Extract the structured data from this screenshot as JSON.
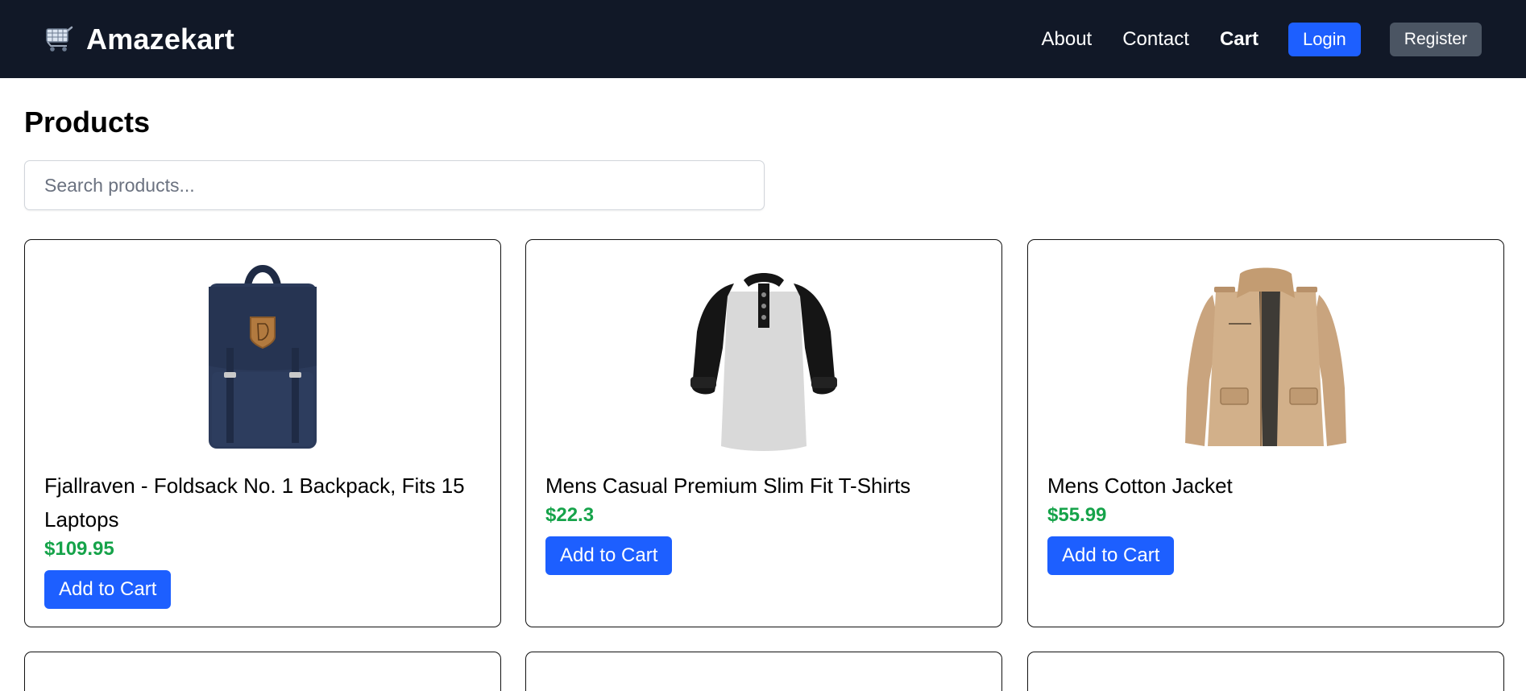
{
  "header": {
    "brand_name": "Amazekart",
    "brand_icon": "shopping-cart-icon",
    "links": {
      "about": "About",
      "contact": "Contact",
      "cart": "Cart"
    },
    "login_label": "Login",
    "register_label": "Register"
  },
  "main": {
    "title": "Products",
    "search": {
      "placeholder": "Search products...",
      "value": ""
    },
    "products": [
      {
        "name": "Fjallraven - Foldsack No. 1 Backpack, Fits 15 Laptops",
        "price": "$109.95",
        "button_label": "Add to Cart",
        "image": "backpack"
      },
      {
        "name": "Mens Casual Premium Slim Fit T-Shirts",
        "price": "$22.3",
        "button_label": "Add to Cart",
        "image": "raglan-henley-shirt"
      },
      {
        "name": "Mens Cotton Jacket",
        "price": "$55.99",
        "button_label": "Add to Cart",
        "image": "khaki-jacket"
      }
    ]
  },
  "colors": {
    "navbar": "#111827",
    "primary_button": "#1d5fff",
    "secondary_button": "#4b5563",
    "price": "#16a34a"
  }
}
